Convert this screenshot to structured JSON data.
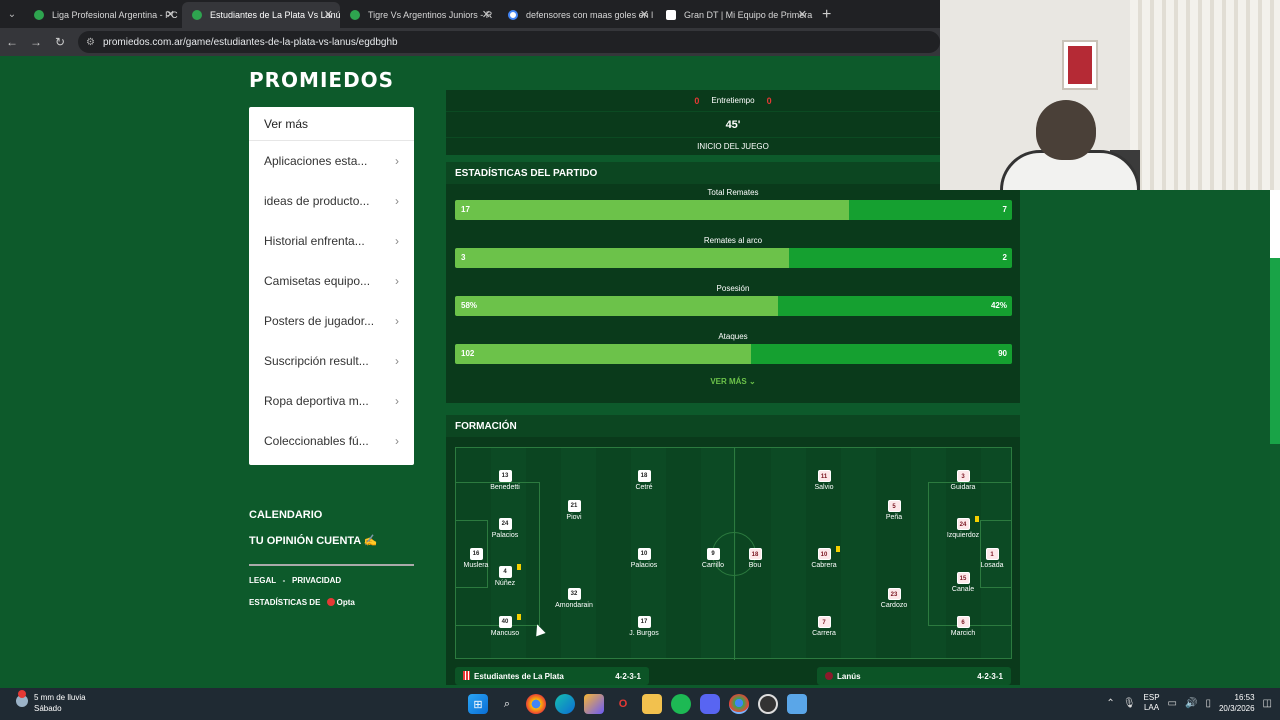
{
  "browser": {
    "tabs": [
      {
        "title": "Liga Profesional Argentina - PC",
        "active": false,
        "favicon": "promiedos-favicon"
      },
      {
        "title": "Estudiantes de La Plata Vs Lanú",
        "active": true,
        "favicon": "promiedos-favicon"
      },
      {
        "title": "Tigre Vs Argentinos Juniors - R",
        "active": false,
        "favicon": "promiedos-favicon"
      },
      {
        "title": "defensores con maas goles en l",
        "active": false,
        "favicon": "google-favicon"
      },
      {
        "title": "Gran DT | Mi Equipo de Primera",
        "active": false,
        "favicon": "grandt-favicon"
      }
    ],
    "url": "promiedos.com.ar/game/estudiantes-de-la-plata-vs-lanus/egdbghb"
  },
  "site": {
    "logo": "PROMIEDOS"
  },
  "sidebar": {
    "title": "Ver más",
    "items": [
      {
        "label": "Aplicaciones esta..."
      },
      {
        "label": "ideas de producto..."
      },
      {
        "label": "Historial enfrenta..."
      },
      {
        "label": "Camisetas equipo..."
      },
      {
        "label": "Posters de jugador..."
      },
      {
        "label": "Suscripción result..."
      },
      {
        "label": "Ropa deportiva m..."
      },
      {
        "label": "Coleccionables fú..."
      }
    ],
    "calendario": "CALENDARIO",
    "opinion": "TU OPINIÓN CUENTA ✍",
    "legal": "LEGAL",
    "privacidad": "PRIVACIDAD",
    "estadisticas_de": "ESTADÍSTICAS DE",
    "opta": "Opta"
  },
  "match": {
    "home_score": "0",
    "away_score": "0",
    "period_label": "Entretiempo",
    "minute": "45'",
    "event": "INICIO DEL JUEGO"
  },
  "stats": {
    "title": "ESTADÍSTICAS DEL PARTIDO",
    "rows": [
      {
        "label": "Total Remates",
        "home": "17",
        "away": "7",
        "home_share": 0.708
      },
      {
        "label": "Remates al arco",
        "home": "3",
        "away": "2",
        "home_share": 0.6
      },
      {
        "label": "Posesión",
        "home": "58%",
        "away": "42%",
        "home_share": 0.58
      },
      {
        "label": "Ataques",
        "home": "102",
        "away": "90",
        "home_share": 0.531
      }
    ],
    "ver_mas": "VER MÁS ⌄"
  },
  "formation": {
    "title": "FORMACIÓN",
    "home_team": "Estudiantes de La Plata",
    "home_system": "4-2-3-1",
    "away_team": "Lanús",
    "away_system": "4-2-3-1",
    "home_players": [
      {
        "num": "16",
        "name": "Muslera"
      },
      {
        "num": "13",
        "name": "Benedetti"
      },
      {
        "num": "24",
        "name": "Palacios"
      },
      {
        "num": "4",
        "name": "Núñez"
      },
      {
        "num": "40",
        "name": "Mancuso"
      },
      {
        "num": "21",
        "name": "Piovi"
      },
      {
        "num": "32",
        "name": "Amondarain"
      },
      {
        "num": "18",
        "name": "Cetré"
      },
      {
        "num": "10",
        "name": "Palacios"
      },
      {
        "num": "17",
        "name": "J. Burgos"
      },
      {
        "num": "9",
        "name": "Carrillo"
      }
    ],
    "away_players": [
      {
        "num": "1",
        "name": "Losada"
      },
      {
        "num": "3",
        "name": "Guidara"
      },
      {
        "num": "24",
        "name": "Izquierdoz"
      },
      {
        "num": "15",
        "name": "Canale"
      },
      {
        "num": "6",
        "name": "Marcich"
      },
      {
        "num": "5",
        "name": "Peña"
      },
      {
        "num": "23",
        "name": "Cardozo"
      },
      {
        "num": "11",
        "name": "Salvio"
      },
      {
        "num": "10",
        "name": "Cabrera"
      },
      {
        "num": "7",
        "name": "Carrera"
      },
      {
        "num": "18",
        "name": "Bou"
      }
    ]
  },
  "taskbar": {
    "weather_temp": "5 mm de lluvia",
    "weather_day": "Sábado",
    "lang": "ESP",
    "lang2": "LAA",
    "time": "16:53",
    "date": "20/3/2026"
  },
  "colors": {
    "home_bar": "#6cc24a",
    "away_bar": "#15a030",
    "page_bg": "#0d5a2b"
  }
}
